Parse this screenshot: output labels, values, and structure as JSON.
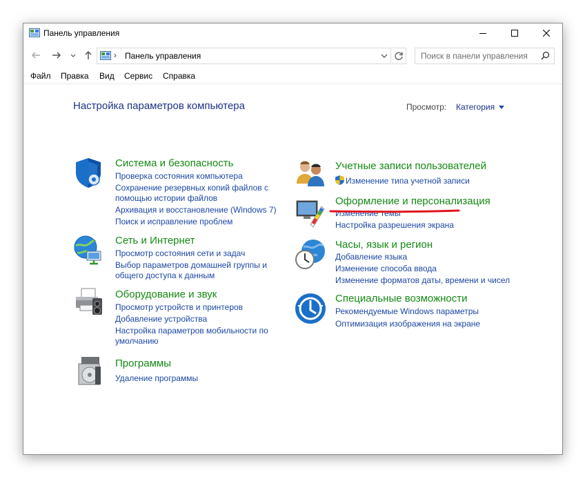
{
  "window": {
    "title": "Панель управления"
  },
  "address": {
    "path": "Панель управления",
    "separator": "›"
  },
  "search": {
    "placeholder": "Поиск в панели управления"
  },
  "menu": [
    "Файл",
    "Правка",
    "Вид",
    "Сервис",
    "Справка"
  ],
  "content": {
    "heading": "Настройка параметров компьютера",
    "view_label": "Просмотр:",
    "view_value": "Категория"
  },
  "categories": [
    {
      "title": "Система и безопасность",
      "icon": "shield-icon",
      "links": [
        "Проверка состояния компьютера",
        "Сохранение резервных копий файлов с",
        "помощью истории файлов",
        "Архивация и восстановление (Windows 7)",
        "Поиск и исправление проблем"
      ]
    },
    {
      "title": "Сеть и Интернет",
      "icon": "network-globe-icon",
      "links": [
        "Просмотр состояния сети и задач",
        "Выбор параметров домашней группы и",
        "общего доступа к данным"
      ]
    },
    {
      "title": "Оборудование и звук",
      "icon": "printer-icon",
      "links": [
        "Просмотр устройств и принтеров",
        "Добавление устройства",
        "Настройка параметров мобильности по",
        "умолчанию"
      ]
    },
    {
      "title": "Программы",
      "icon": "programs-icon",
      "links": [
        "Удаление программы"
      ]
    },
    {
      "title": "Учетные записи пользователей",
      "icon": "users-icon",
      "links": [
        "Изменение типа учетной записи"
      ]
    },
    {
      "title": "Оформление и персонализация",
      "icon": "display-palette-icon",
      "links": [
        "Изменение темы",
        "Настройка разрешения экрана"
      ]
    },
    {
      "title": "Часы, язык и регион",
      "icon": "clock-globe-icon",
      "links": [
        "Добавление языка",
        "Изменение способа ввода",
        "Изменение форматов даты, времени и чисел"
      ]
    },
    {
      "title": "Специальные возможности",
      "icon": "accessibility-icon",
      "links": [
        "Рекомендуемые Windows параметры",
        "Оптимизация изображения на экране"
      ]
    }
  ],
  "colors": {
    "category_title": "#138a13",
    "link": "#1c47a5",
    "heading": "#1e3287",
    "highlight_underline": "#e0141e"
  }
}
